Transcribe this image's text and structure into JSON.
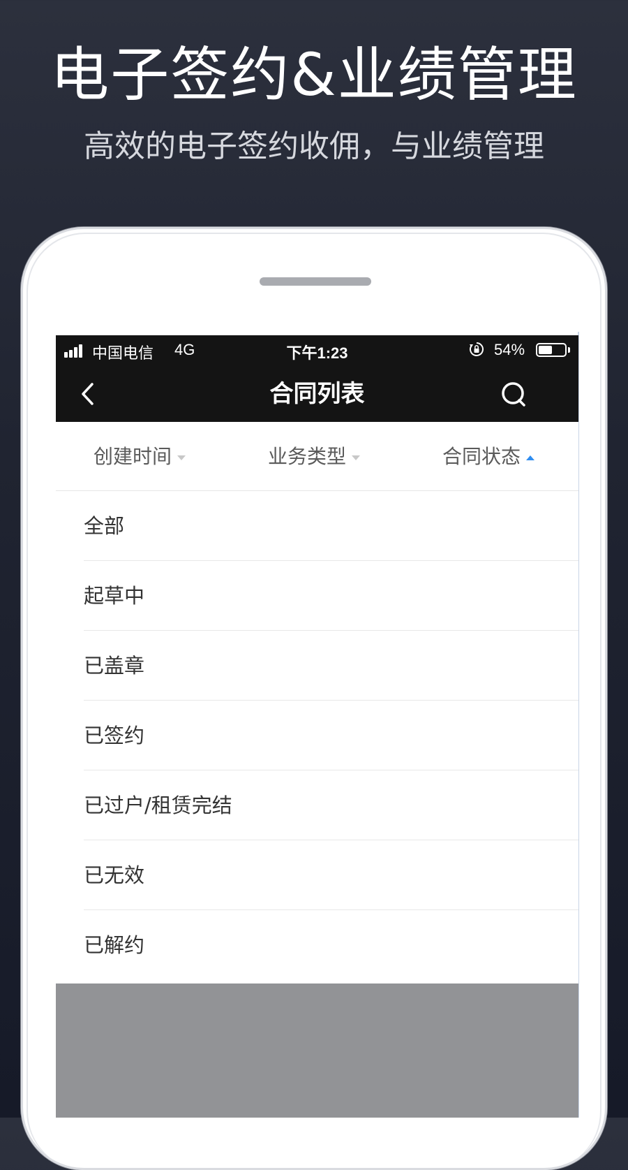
{
  "promo": {
    "headline": "电子签约&业绩管理",
    "subheadline": "高效的电子签约收佣，与业绩管理"
  },
  "status_bar": {
    "carrier": "中国电信",
    "network": "4G",
    "time": "下午1:23",
    "battery_percent": "54%",
    "battery_level": 0.54
  },
  "nav": {
    "title": "合同列表",
    "back_icon": "chevron-left-icon",
    "search_icon": "search-icon"
  },
  "filters": [
    {
      "label": "创建时间",
      "expanded": false
    },
    {
      "label": "业务类型",
      "expanded": false
    },
    {
      "label": "合同状态",
      "expanded": true
    }
  ],
  "status_options": [
    {
      "label": "全部"
    },
    {
      "label": "起草中"
    },
    {
      "label": "已盖章"
    },
    {
      "label": "已签约"
    },
    {
      "label": "已过户/租赁完结"
    },
    {
      "label": "已无效"
    },
    {
      "label": "已解约"
    }
  ],
  "colors": {
    "accent": "#2f8df0",
    "nav_background": "#141414",
    "overlay": "#929396"
  }
}
